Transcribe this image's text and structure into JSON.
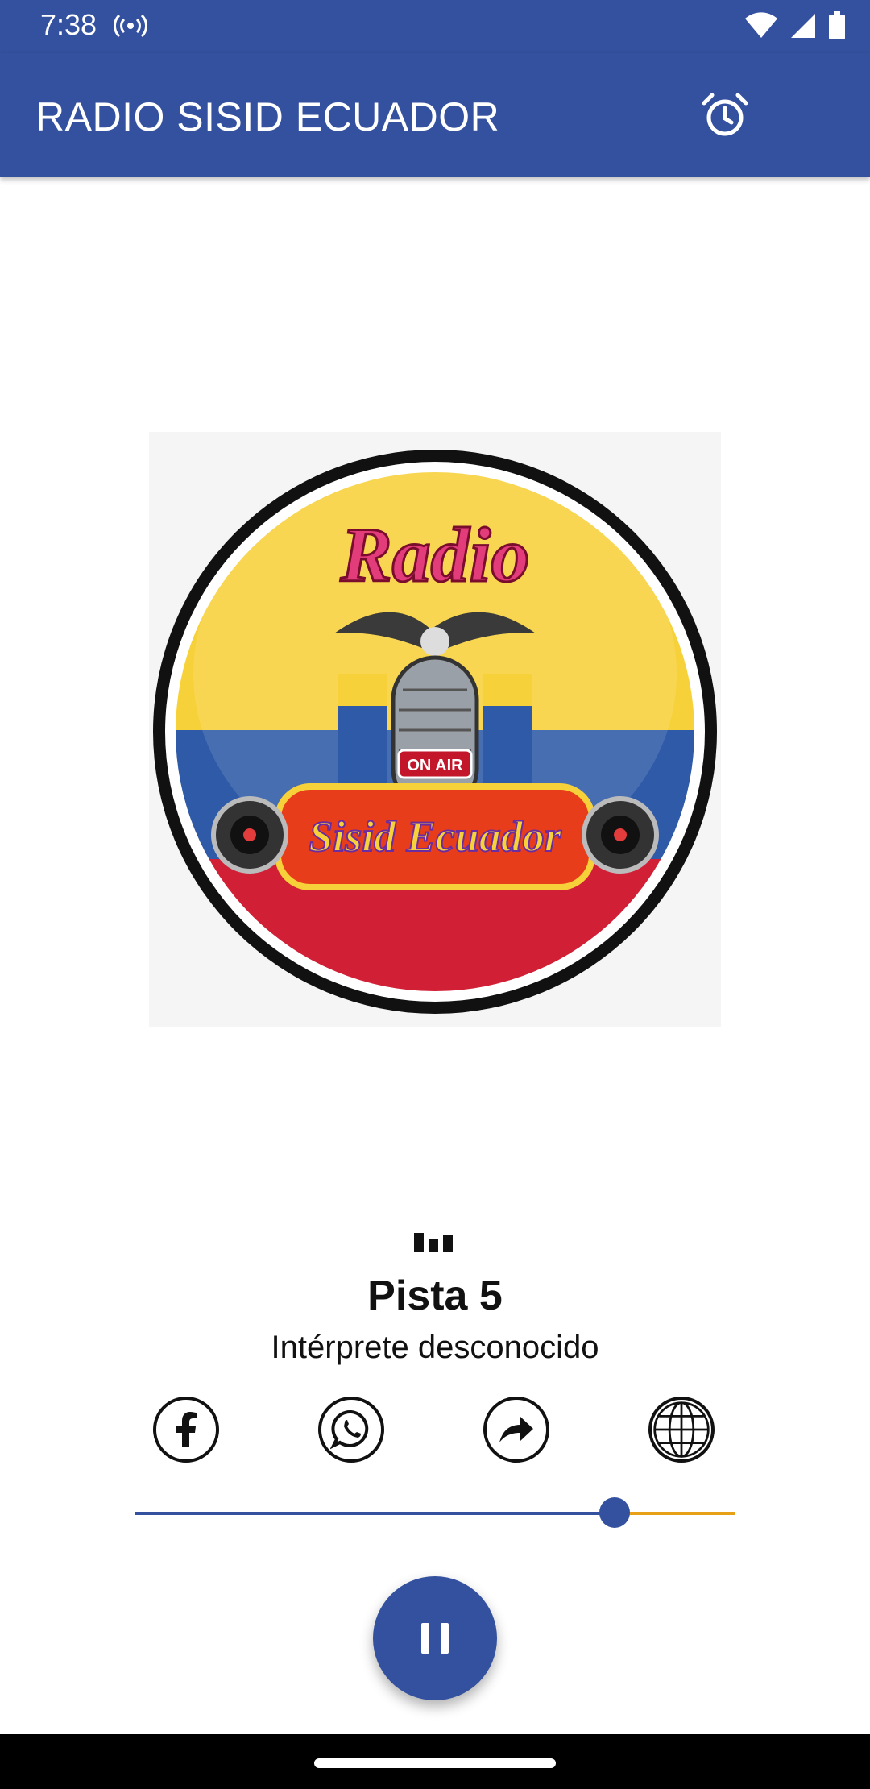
{
  "status_bar": {
    "time": "7:38"
  },
  "app_bar": {
    "title": "RADIO SISID ECUADOR",
    "alarm_icon": "alarm-clock-icon"
  },
  "artwork": {
    "logo_text_top": "Radio",
    "logo_badge": "ON AIR",
    "logo_text_bottom": "Sisid Ecuador",
    "colors": {
      "yellow": "#f7d13a",
      "blue": "#2f5aa8",
      "red": "#d11f35"
    }
  },
  "now_playing": {
    "track": "Pista 5",
    "artist": "Intérprete desconocido"
  },
  "share_buttons": [
    {
      "name": "facebook",
      "icon": "facebook-icon"
    },
    {
      "name": "whatsapp",
      "icon": "whatsapp-icon"
    },
    {
      "name": "share",
      "icon": "share-icon"
    },
    {
      "name": "website",
      "icon": "globe-icon"
    }
  ],
  "player": {
    "progress_fraction": 0.8,
    "state_icon": "pause-icon"
  },
  "theme": {
    "primary": "#34519f",
    "accent": "#e8a019"
  }
}
